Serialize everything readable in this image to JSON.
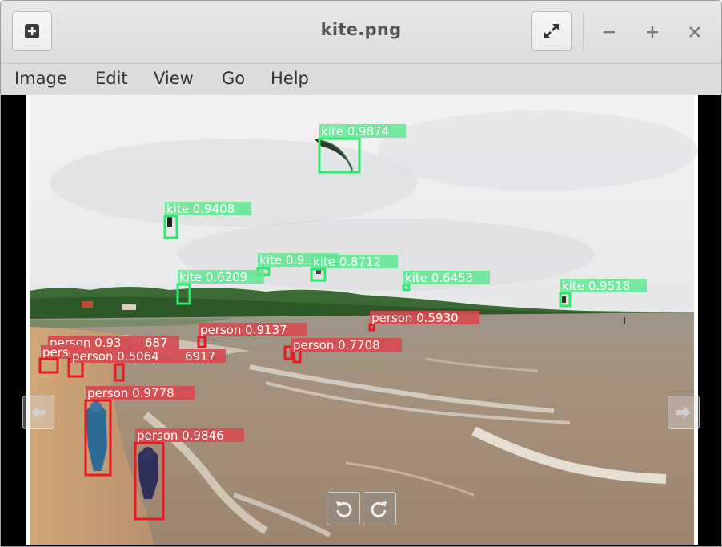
{
  "window": {
    "title": "kite.png",
    "new_window_icon": "plus-square-icon",
    "fullscreen_icon": "fullscreen-arrows-icon",
    "minimize_icon": "minimize-icon",
    "maximize_icon": "maximize-icon",
    "close_icon": "close-icon"
  },
  "menu": [
    "Image",
    "Edit",
    "View",
    "Go",
    "Help"
  ],
  "colors": {
    "kite_box": "#2ee86a",
    "kite_label_bg": "#5fe892",
    "person_box": "#e8191f",
    "person_label_bg": "#d84a4f",
    "label_text": "#ffffff"
  },
  "detections": [
    {
      "class": "kite",
      "label": "kite 0.9874"
    },
    {
      "class": "kite",
      "label": "kite 0.9408"
    },
    {
      "class": "kite",
      "label": "kite 0.9..."
    },
    {
      "class": "kite",
      "label": "kite 0.8712"
    },
    {
      "class": "kite",
      "label": "kite 0.6209"
    },
    {
      "class": "kite",
      "label": "kite 0.6453"
    },
    {
      "class": "kite",
      "label": "kite 0.9518"
    },
    {
      "class": "person",
      "label": "person 0.5930"
    },
    {
      "class": "person",
      "label": "person 0.9137"
    },
    {
      "class": "person",
      "label": "person 0.7708"
    },
    {
      "class": "person",
      "label": "person 0.93"
    },
    {
      "class": "person",
      "label": "person 0.5064"
    },
    {
      "class": "person",
      "label": "person 0.9778"
    },
    {
      "class": "person",
      "label": "person 0.9846"
    },
    {
      "class": "person",
      "label": "6917"
    },
    {
      "class": "person",
      "label": "687"
    },
    {
      "class": "person",
      "label": "person"
    }
  ],
  "controls": {
    "prev_icon": "arrow-left-icon",
    "next_icon": "arrow-right-icon",
    "rotate_left_icon": "rotate-counterclockwise-icon",
    "rotate_right_icon": "rotate-clockwise-icon"
  }
}
